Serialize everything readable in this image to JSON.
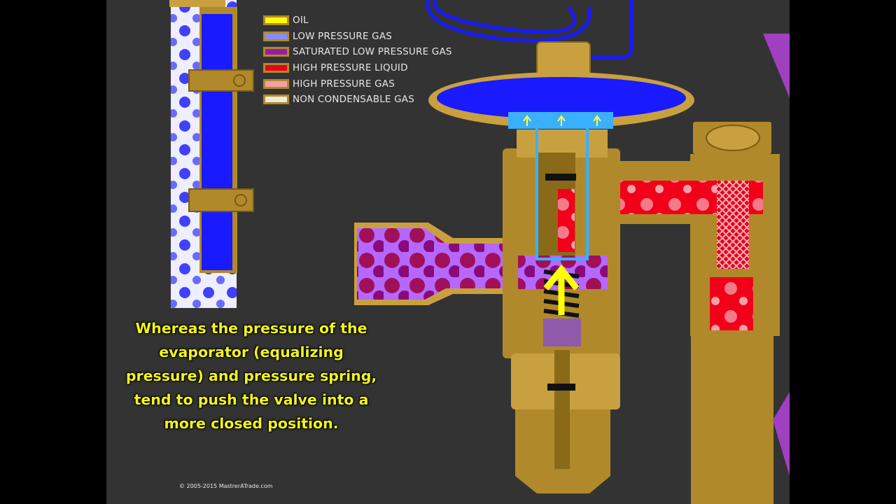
{
  "legend": [
    {
      "label": "OIL",
      "color": "#ffff00",
      "icon": "oil-swatch"
    },
    {
      "label": "LOW PRESSURE GAS",
      "color": "#8a8aff",
      "icon": "low-pressure-gas-swatch"
    },
    {
      "label": "SATURATED LOW PRESSURE GAS",
      "color": "#9a1aa8",
      "icon": "saturated-low-pressure-gas-swatch"
    },
    {
      "label": "HIGH PRESSURE LIQUID",
      "color": "#e8001a",
      "icon": "high-pressure-liquid-swatch"
    },
    {
      "label": "HIGH PRESSURE GAS",
      "color": "#f4a0a8",
      "icon": "high-pressure-gas-swatch"
    },
    {
      "label": "NON CONDENSABLE GAS",
      "color": "#f0ead8",
      "icon": "non-condensable-gas-swatch"
    }
  ],
  "caption": {
    "line1": "Whereas the pressure of the",
    "line2": "evaporator (equalizing",
    "line3": "pressure) and pressure spring,",
    "line4": "tend to push the valve into a",
    "line5": "more closed position."
  },
  "copyright": "© 2005-2015 MastrerATrade.com",
  "colors": {
    "brass": "#b08a2a",
    "background": "#333333",
    "low_pressure_gas": "#1a1aff",
    "caption": "#f2f51a"
  }
}
